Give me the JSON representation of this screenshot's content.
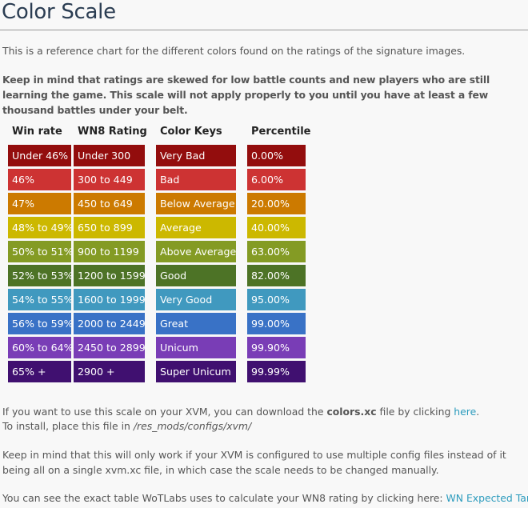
{
  "title": "Color Scale",
  "intro": "This is a reference chart for the different colors found on the ratings of the signature images.",
  "warning": "Keep in mind that ratings are skewed for low battle counts and new players who are still learning the game. This scale will not apply properly to you until you have at least a few thousand battles under your belt.",
  "table": {
    "headers": [
      "Win rate",
      "WN8 Rating",
      "Color Keys",
      "Percentile"
    ],
    "rows": [
      {
        "winrate": "Under 46%",
        "wn8": "Under 300",
        "key": "Very Bad",
        "percentile": "0.00%",
        "color": "#930d0d"
      },
      {
        "winrate": "46%",
        "wn8": "300 to 449",
        "key": "Bad",
        "percentile": "6.00%",
        "color": "#cd3333"
      },
      {
        "winrate": "47%",
        "wn8": "450 to 649",
        "key": "Below Average",
        "percentile": "20.00%",
        "color": "#cc7a00"
      },
      {
        "winrate": "48% to 49%",
        "wn8": "650 to 899",
        "key": "Average",
        "percentile": "40.00%",
        "color": "#ccb800"
      },
      {
        "winrate": "50% to 51%",
        "wn8": "900 to 1199",
        "key": "Above Average",
        "percentile": "63.00%",
        "color": "#849b24"
      },
      {
        "winrate": "52% to 53%",
        "wn8": "1200 to 1599",
        "key": "Good",
        "percentile": "82.00%",
        "color": "#4d7326"
      },
      {
        "winrate": "54% to 55%",
        "wn8": "1600 to 1999",
        "key": "Very Good",
        "percentile": "95.00%",
        "color": "#4099bf"
      },
      {
        "winrate": "56% to 59%",
        "wn8": "2000 to 2449",
        "key": "Great",
        "percentile": "99.00%",
        "color": "#3972c6"
      },
      {
        "winrate": "60% to 64%",
        "wn8": "2450 to 2899",
        "key": "Unicum",
        "percentile": "99.90%",
        "color": "#793db6"
      },
      {
        "winrate": "65% +",
        "wn8": "2900 +",
        "key": "Super Unicum",
        "percentile": "99.99%",
        "color": "#401070"
      }
    ]
  },
  "download": {
    "prefix": "If you want to use this scale on your XVM, you can download the ",
    "filename": "colors.xc",
    "middle": " file by clicking ",
    "link": "here",
    "suffix": "."
  },
  "install": {
    "prefix": "To install, place this file in ",
    "path": "/res_mods/configs/xvm/"
  },
  "note": "Keep in mind that this will only work if your XVM is configured to use multiple config files instead of it being all on a single xvm.xc file, in which case the scale needs to be changed manually.",
  "expected": {
    "prefix": "You can see the exact table WoTLabs uses to calculate your WN8 rating by clicking here: ",
    "link": "WN Expected Tank"
  }
}
